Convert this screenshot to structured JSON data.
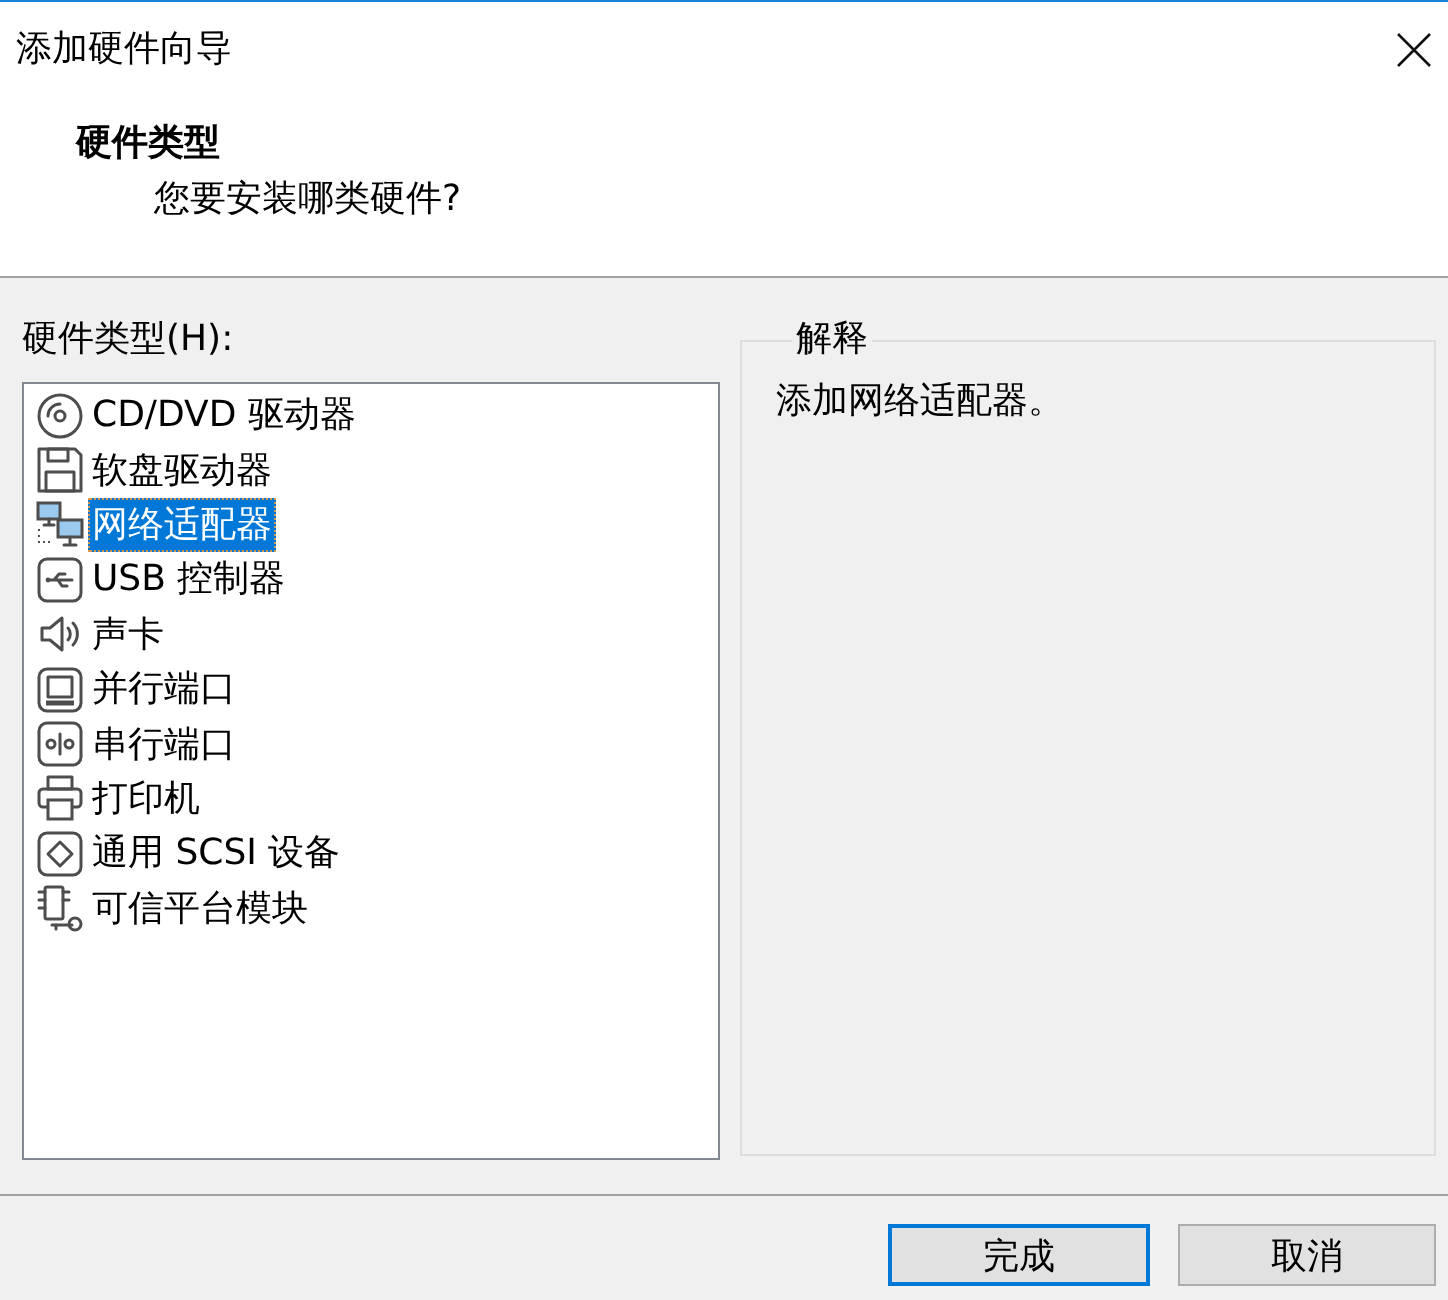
{
  "window": {
    "title": "添加硬件向导"
  },
  "header": {
    "title": "硬件类型",
    "subtitle": "您要安装哪类硬件?"
  },
  "hardware_list": {
    "label": "硬件类型(H):",
    "items": [
      {
        "label": "CD/DVD 驱动器",
        "kind": "cd",
        "selected": false
      },
      {
        "label": "软盘驱动器",
        "kind": "floppy",
        "selected": false
      },
      {
        "label": "网络适配器",
        "kind": "network",
        "selected": true
      },
      {
        "label": "USB 控制器",
        "kind": "usb",
        "selected": false
      },
      {
        "label": "声卡",
        "kind": "sound",
        "selected": false
      },
      {
        "label": "并行端口",
        "kind": "parallel",
        "selected": false
      },
      {
        "label": "串行端口",
        "kind": "serial",
        "selected": false
      },
      {
        "label": "打印机",
        "kind": "printer",
        "selected": false
      },
      {
        "label": "通用 SCSI 设备",
        "kind": "scsi",
        "selected": false
      },
      {
        "label": "可信平台模块",
        "kind": "tpm",
        "selected": false
      }
    ]
  },
  "description": {
    "title": "解释",
    "text": "添加网络适配器。"
  },
  "buttons": [
    {
      "label": "完成",
      "default": true
    },
    {
      "label": "取消",
      "default": false
    }
  ]
}
